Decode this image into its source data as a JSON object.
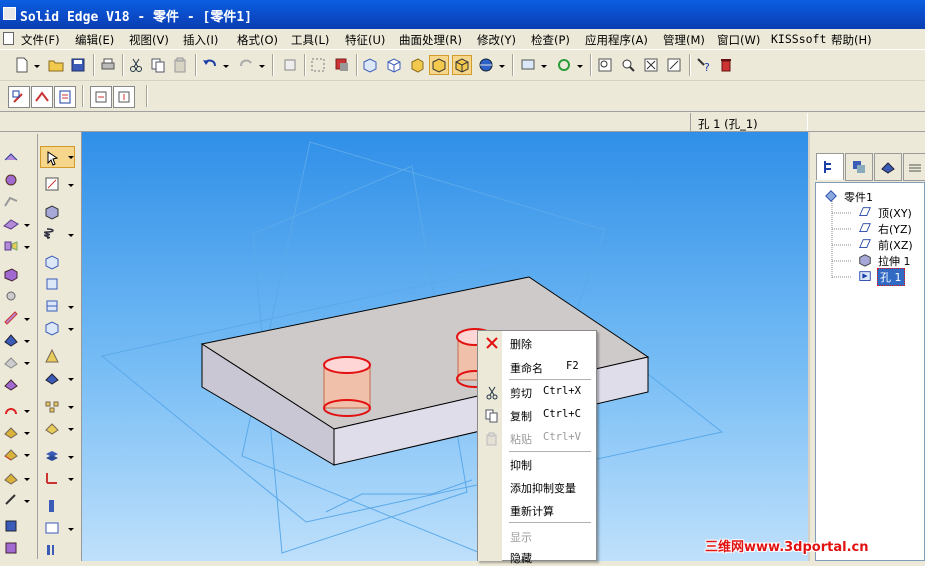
{
  "window": {
    "title": "Solid Edge V18 - 零件 - [零件1]"
  },
  "menu": [
    {
      "label": "文件(F)"
    },
    {
      "label": "编辑(E)"
    },
    {
      "label": "视图(V)"
    },
    {
      "label": "插入(I)"
    },
    {
      "label": "格式(O)"
    },
    {
      "label": "工具(L)"
    },
    {
      "label": "特征(U)"
    },
    {
      "label": "曲面处理(R)"
    },
    {
      "label": "修改(Y)"
    },
    {
      "label": "检查(P)"
    },
    {
      "label": "应用程序(A)"
    },
    {
      "label": "管理(M)"
    },
    {
      "label": "窗口(W)"
    },
    {
      "label": "KISSsoft"
    },
    {
      "label": "帮助(H)"
    }
  ],
  "toolbar": {
    "main_icons": [
      "new-icon",
      "open-icon",
      "save-icon",
      "print-icon",
      "cut-icon",
      "copy-icon",
      "paste-icon",
      "undo-icon",
      "redo-icon",
      "new-window-icon",
      "select-icon",
      "select-tools-icon",
      "front-view-icon",
      "iso-view-icon",
      "shaded-icon",
      "shaded-edges-icon",
      "shaded-visible-icon",
      "render-sphere-icon",
      "view-style-icon",
      "rotate-icon",
      "fit-icon",
      "zoom-area-icon",
      "zoom-icon",
      "pan-icon",
      "whats-this-icon",
      "delete-icon"
    ],
    "secondary_icons": [
      "sketch-icon",
      "profile-icon",
      "property-icon",
      "feature-a-icon",
      "feature-b-icon"
    ]
  },
  "status": {
    "selection": "孔 1 (孔_1)"
  },
  "feature_tree": {
    "root": "零件1",
    "items": [
      {
        "label": "顶(XY)",
        "icon": "plane-icon"
      },
      {
        "label": "右(YZ)",
        "icon": "plane-icon"
      },
      {
        "label": "前(XZ)",
        "icon": "plane-icon"
      },
      {
        "label": "拉伸 1",
        "icon": "extrude-icon"
      },
      {
        "label": "孔 1",
        "icon": "hole-icon",
        "selected": true
      }
    ]
  },
  "context_menu": {
    "items": [
      {
        "label": "删除",
        "shortcut": "",
        "icon": "delete-x-icon",
        "disabled": false
      },
      {
        "label": "重命名",
        "shortcut": "F2",
        "icon": "",
        "disabled": false
      },
      {
        "label": "剪切",
        "shortcut": "Ctrl+X",
        "icon": "cut-icon",
        "disabled": false
      },
      {
        "label": "复制",
        "shortcut": "Ctrl+C",
        "icon": "copy-icon",
        "disabled": false
      },
      {
        "label": "粘贴",
        "shortcut": "Ctrl+V",
        "icon": "paste-icon",
        "disabled": true
      },
      {
        "label": "抑制",
        "shortcut": "",
        "icon": "",
        "disabled": false
      },
      {
        "label": "添加抑制变量",
        "shortcut": "",
        "icon": "",
        "disabled": false
      },
      {
        "label": "重新计算",
        "shortcut": "",
        "icon": "",
        "disabled": false
      },
      {
        "label": "显示",
        "shortcut": "",
        "icon": "",
        "disabled": true
      },
      {
        "label": "隐藏",
        "shortcut": "",
        "icon": "",
        "disabled": false
      }
    ]
  },
  "watermark": {
    "text": "三维网www.3dportal.cn"
  },
  "colors": {
    "title_blue": "#0b49c6",
    "viewport_top": "#2f8fe8",
    "hole_red": "#e31212",
    "selection_blue": "#316ac5"
  }
}
